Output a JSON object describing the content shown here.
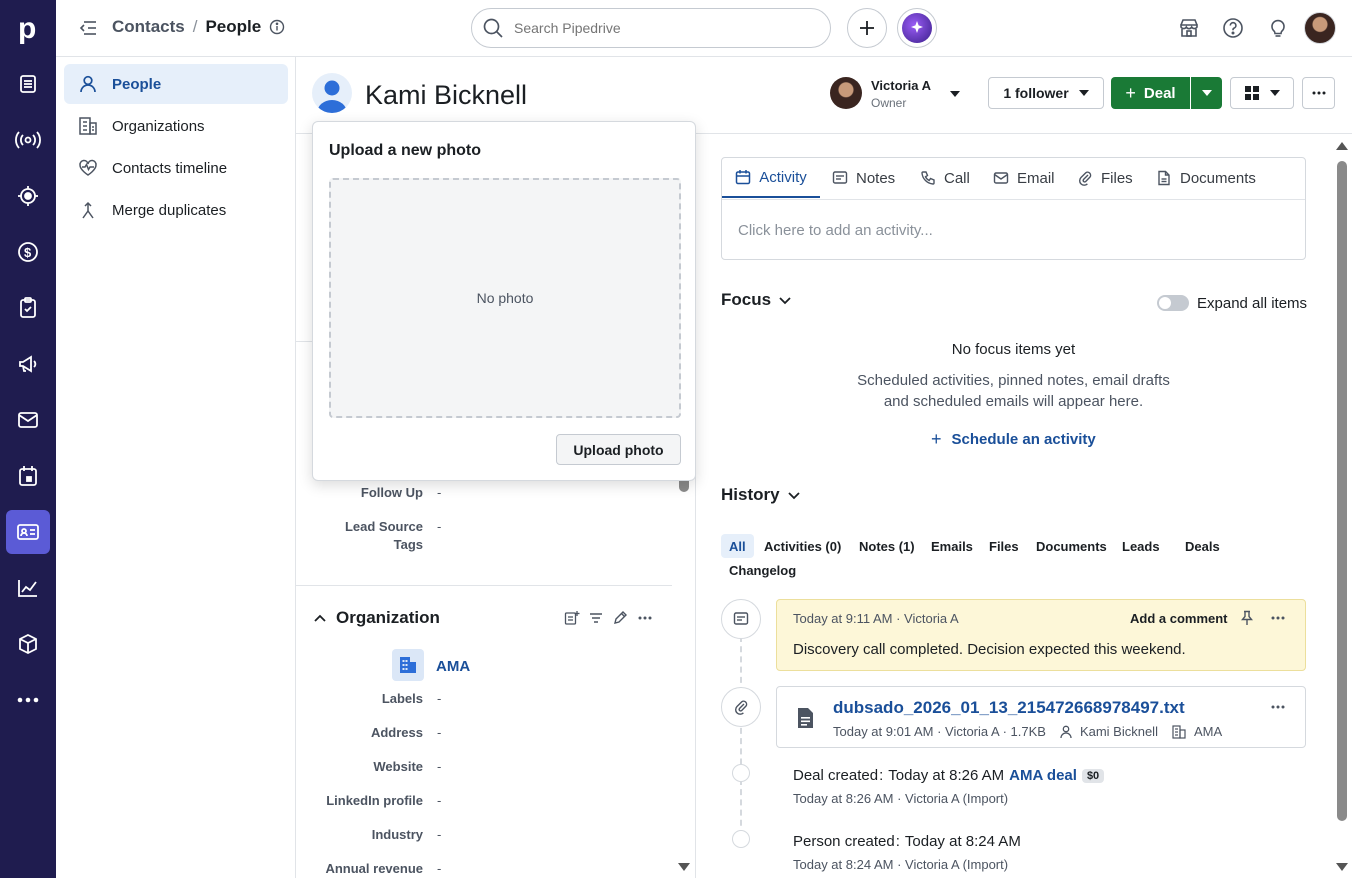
{
  "breadcrumb": {
    "parent": "Contacts",
    "separator": "/",
    "current": "People"
  },
  "search": {
    "placeholder": "Search Pipedrive"
  },
  "sidenav": {
    "items": [
      {
        "label": "People"
      },
      {
        "label": "Organizations"
      },
      {
        "label": "Contacts timeline"
      },
      {
        "label": "Merge duplicates"
      }
    ]
  },
  "person": {
    "name": "Kami Bicknell"
  },
  "owner": {
    "name": "Victoria A",
    "role": "Owner"
  },
  "header": {
    "follower_label": "1 follower",
    "deal_label": "Deal",
    "deal_plus": "+"
  },
  "upload_popover": {
    "title": "Upload a new photo",
    "placeholder": "No photo",
    "button": "Upload photo"
  },
  "details": {
    "fields": [
      {
        "label": "Follow Up",
        "value": "-"
      },
      {
        "label": "Lead Source",
        "label2": "Tags",
        "value": "-"
      }
    ]
  },
  "organization": {
    "section_title": "Organization",
    "name": "AMA",
    "fields": [
      {
        "label": "Labels",
        "value": "-"
      },
      {
        "label": "Address",
        "value": "-"
      },
      {
        "label": "Website",
        "value": "-"
      },
      {
        "label": "LinkedIn profile",
        "value": "-"
      },
      {
        "label": "Industry",
        "value": "-"
      },
      {
        "label": "Annual revenue",
        "value": "-"
      }
    ]
  },
  "composer": {
    "tabs": [
      {
        "label": "Activity"
      },
      {
        "label": "Notes"
      },
      {
        "label": "Call"
      },
      {
        "label": "Email"
      },
      {
        "label": "Files"
      },
      {
        "label": "Documents"
      }
    ],
    "placeholder": "Click here to add an activity..."
  },
  "focus": {
    "title": "Focus",
    "expand_label": "Expand all items",
    "empty_title": "No focus items yet",
    "empty_line1": "Scheduled activities, pinned notes, email drafts",
    "empty_line2": "and scheduled emails will appear here.",
    "schedule_plus": "+",
    "schedule_label": "Schedule an activity"
  },
  "history": {
    "title": "History",
    "filters": [
      {
        "label": "All"
      },
      {
        "label": "Activities (0)"
      },
      {
        "label": "Notes (1)"
      },
      {
        "label": "Emails"
      },
      {
        "label": "Files"
      },
      {
        "label": "Documents"
      },
      {
        "label": "Leads"
      },
      {
        "label": "Deals"
      },
      {
        "label": "Changelog"
      }
    ],
    "note": {
      "meta": "Today at 9:11 AM · Victoria A",
      "add_comment": "Add a comment",
      "text": "Discovery call completed. Decision expected this weekend."
    },
    "file": {
      "name": "dubsado_2026_01_13_215472668978497.txt",
      "meta": "Today at 9:01 AM · Victoria A · 1.7KB",
      "person": "Kami Bicknell",
      "org": "AMA"
    },
    "deal_event": {
      "label": "Deal created",
      "colon": ":",
      "time": "Today at 8:26 AM",
      "link": "AMA deal",
      "badge": "$0",
      "meta": "Today at 8:26 AM · Victoria A (Import)"
    },
    "person_event": {
      "label": "Person created",
      "colon": ":",
      "time": "Today at 8:24 AM",
      "meta": "Today at 8:24 AM · Victoria A (Import)"
    }
  },
  "rail_icons": [
    "pipedrive-logo-icon",
    "leads-inbox-icon",
    "broadcast-icon",
    "target-icon",
    "dollar-icon",
    "clipboard-check-icon",
    "megaphone-icon",
    "mail-icon",
    "calendar-icon",
    "contacts-card-icon",
    "chart-line-icon",
    "box-icon",
    "more-icon"
  ],
  "colors": {
    "rail": "#1f1c4f",
    "rail_active": "#5b5bd6",
    "primary_green": "#1a7a36",
    "link_blue": "#1a4f99",
    "note_bg": "#fdf7d8"
  }
}
